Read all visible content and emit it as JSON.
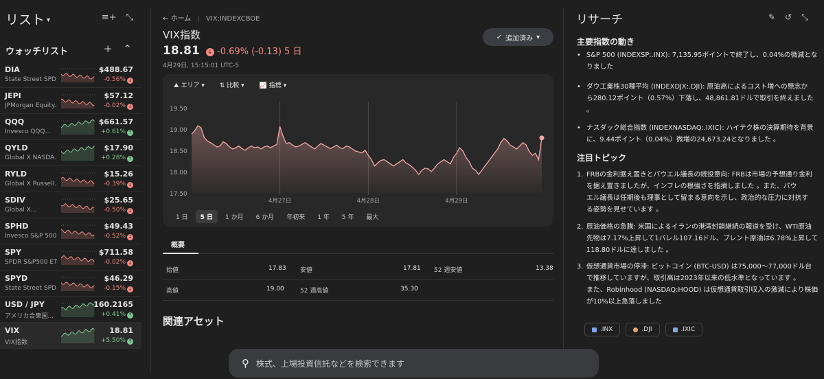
{
  "left": {
    "title": "リスト",
    "watchlist_label": "ウォッチリスト",
    "items": [
      {
        "symbol": "DIA",
        "name": "State Street SPD...",
        "price": "$488.67",
        "change": "-0.56%",
        "dir": "neg"
      },
      {
        "symbol": "JEPI",
        "name": "JPMorgan Equity...",
        "price": "$57.12",
        "change": "-0.02%",
        "dir": "neg"
      },
      {
        "symbol": "QQQ",
        "name": "Invesco QQQ...",
        "price": "$661.57",
        "change": "+0.61%",
        "dir": "pos"
      },
      {
        "symbol": "QYLD",
        "name": "Global X NASDA...",
        "price": "$17.90",
        "change": "+0.28%",
        "dir": "pos"
      },
      {
        "symbol": "RYLD",
        "name": "Global X Russell...",
        "price": "$15.26",
        "change": "-0.39%",
        "dir": "neg"
      },
      {
        "symbol": "SDIV",
        "name": "Global X...",
        "price": "$25.65",
        "change": "-0.50%",
        "dir": "neg"
      },
      {
        "symbol": "SPHD",
        "name": "Invesco S&P 500...",
        "price": "$49.43",
        "change": "-0.52%",
        "dir": "neg"
      },
      {
        "symbol": "SPY",
        "name": "SPDR S&P500 ETF",
        "price": "$711.58",
        "change": "-0.02%",
        "dir": "neg"
      },
      {
        "symbol": "SPYD",
        "name": "State Street SPD...",
        "price": "$46.29",
        "change": "-0.15%",
        "dir": "neg"
      },
      {
        "symbol": "USD / JPY",
        "name": "アメリカ合衆国...",
        "price": "160.2165",
        "change": "+0.41%",
        "dir": "pos"
      },
      {
        "symbol": "VIX",
        "name": "VIX指数",
        "price": "18.81",
        "change": "+5.50%",
        "dir": "pos"
      }
    ]
  },
  "main": {
    "home_label": "ホーム",
    "ticker": "VIX:INDEXCBOE",
    "title": "VIX指数",
    "price": "18.81",
    "change": "-0.69% (-0.13) 5 日",
    "timestamp": "4月29日, 15:15:01 UTC-5",
    "added_label": "追加済み",
    "toolbar": {
      "area": "エリア",
      "compare": "比較",
      "indicators": "指標"
    },
    "ranges": [
      "1 日",
      "5 日",
      "1 か月",
      "6 か月",
      "年初来",
      "1 年",
      "5 年",
      "最大"
    ],
    "active_range": "5 日",
    "overview_tab": "概要",
    "stats": [
      [
        {
          "l": "始値",
          "v": "17.83"
        },
        {
          "l": "安値",
          "v": "17.81"
        },
        {
          "l": "52 週安値",
          "v": "13.38"
        }
      ],
      [
        {
          "l": "高値",
          "v": "19.00"
        },
        {
          "l": "52 週高値",
          "v": "35.30"
        }
      ]
    ],
    "related_title": "関連アセット"
  },
  "chart_data": {
    "type": "area",
    "x_ticks": [
      "4月27日",
      "4月28日",
      "4月29日"
    ],
    "y_ticks": [
      "19.50",
      "19.00",
      "18.50",
      "18.00",
      "17.50"
    ],
    "ylim": [
      17.5,
      19.6
    ],
    "sessions": [
      [
        18.9,
        18.98,
        19.1,
        19.05,
        18.82,
        18.74,
        18.7,
        18.65,
        18.6,
        18.62,
        18.72,
        18.68,
        18.6,
        18.55,
        18.58,
        18.62,
        18.56,
        18.52,
        18.58,
        18.62,
        18.58,
        18.6,
        18.55,
        18.6,
        18.62,
        18.58,
        18.62,
        18.66
      ],
      [
        19.08,
        18.85,
        18.68,
        18.7,
        18.64,
        18.6,
        18.62,
        18.66,
        18.7,
        18.65,
        18.6,
        18.55,
        18.62,
        18.68,
        18.64,
        18.6,
        18.56,
        18.6,
        18.64,
        18.58,
        18.56,
        18.62,
        18.6,
        18.55,
        18.5,
        18.48,
        18.46,
        18.52
      ],
      [
        18.4,
        18.3,
        18.15,
        18.22,
        18.28,
        18.3,
        18.25,
        18.2,
        18.15,
        18.2,
        18.25,
        18.3,
        18.22,
        18.18,
        18.12,
        18.05,
        17.95,
        18.05,
        18.1,
        18.08,
        18.02,
        18.1,
        18.2,
        18.25,
        18.3,
        18.25,
        18.2,
        18.35
      ],
      [
        18.45,
        18.58,
        18.5,
        18.35,
        18.25,
        18.1,
        18.05,
        17.95,
        18.05,
        18.15,
        18.25,
        18.35,
        18.45,
        18.55,
        18.7,
        18.8,
        18.74,
        18.64,
        18.6,
        18.55,
        18.62,
        18.7,
        18.65,
        18.5,
        18.4,
        18.45,
        18.3,
        18.81
      ]
    ]
  },
  "research": {
    "title": "リサーチ",
    "section1": "主要指数の動き",
    "bullets": [
      {
        "b": "S&P 500 (INDEXSP:.INX):",
        "t": "7,135.95ポイントで終了し、0.04%の微減となりました",
        "lines": [
          "S&P 500 (INDEXSP:.INX): 7,135.95ポイントで終了し、0.04%の微減とな",
          "りました"
        ]
      },
      {
        "lines": [
          "ダウ工業株30種平均 (INDEXDJX:.DJI): 原油高によるコスト増への懸念か",
          "ら280.12ポイント（0.57%）下落し、48,861.81ドルで取引を終えました",
          "。"
        ]
      },
      {
        "lines": [
          "ナスダック総合指数 (INDEXNASDAQ:.IXIC): ハイテク株の決算期待を背景",
          "に、9.44ポイント（0.04%）微増の24,673.24となりました 。"
        ]
      }
    ],
    "section2": "注目トピック",
    "topics": [
      {
        "n": "1.",
        "lines": [
          "FRBの金利据え置きとパウエル議長の続投意向: FRBは市場の予想通り金利",
          "を据え置きましたが、インフレの根強さを指摘しました 。また、パウ",
          "エル議長は任期後も理事として留まる意向を示し、政治的な圧力に対抗す",
          "る姿勢を見せています 。"
        ]
      },
      {
        "n": "2.",
        "lines": [
          "原油価格の急騰: 米国によるイランの港湾封鎖継続の報道を受け、WTI原油",
          "先物は7.17%上昇して1バレル107.16ドル、ブレント原油は6.78%上昇して",
          "118.80ドルに達しました 。"
        ]
      },
      {
        "n": "3.",
        "lines": [
          "仮想通貨市場の停滞: ビットコイン (BTC-USD) は75,000〜77,000ドル台",
          "で推移していますが、取引高は2023年以来の低水準となっています 。",
          "また、Robinhood (NASDAQ:HOOD) は仮想通貨取引収入の激減により株価",
          "が10%以上急落しました"
        ]
      }
    ],
    "chips": [
      ".INX",
      ".DJI",
      ".IXIC"
    ]
  },
  "search": {
    "placeholder": "株式、上場投資信託などを検索できます"
  },
  "colors": {
    "negative": "#f28b82",
    "positive": "#81c995",
    "chart_line": "#f6a6a6"
  }
}
